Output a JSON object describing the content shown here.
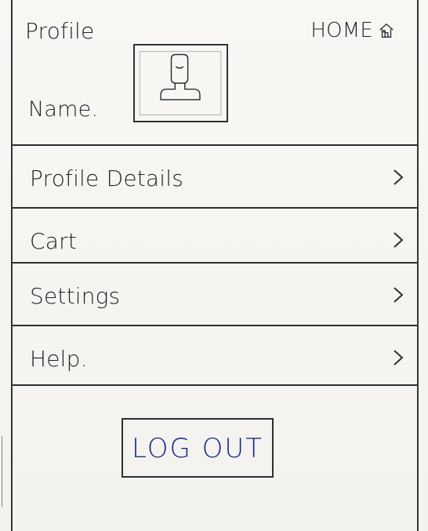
{
  "header": {
    "title": "Profile",
    "home_label": "HOME"
  },
  "profile": {
    "name_label": "Name."
  },
  "menu": {
    "items": [
      {
        "label": "Profile Details"
      },
      {
        "label": "Cart"
      },
      {
        "label": "Settings"
      },
      {
        "label": "Help."
      }
    ]
  },
  "actions": {
    "logout_label": "LOG OUT"
  },
  "icons": {
    "home": "home-icon",
    "chevron": "chevron-right-icon",
    "avatar": "avatar-icon"
  }
}
